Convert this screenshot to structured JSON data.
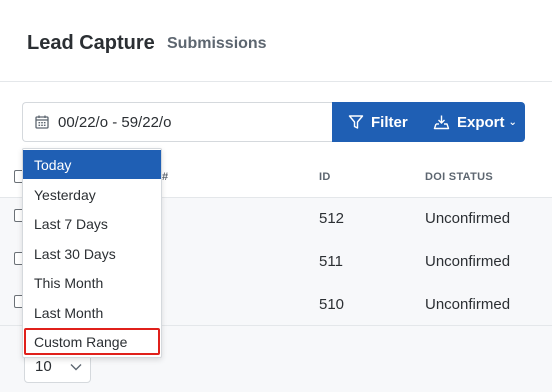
{
  "header": {
    "title": "Lead Capture",
    "subtitle": "Submissions"
  },
  "toolbar": {
    "date_range": "00/22/o - 59/22/o",
    "filter_label": "Filter",
    "export_label": "Export",
    "export_caret": "⌄"
  },
  "table": {
    "columns": [
      "#",
      "ID",
      "DOI STATUS"
    ],
    "rows": [
      {
        "id": "512",
        "doi_status": "Unconfirmed"
      },
      {
        "id": "511",
        "doi_status": "Unconfirmed"
      },
      {
        "id": "510",
        "doi_status": "Unconfirmed"
      }
    ]
  },
  "footer": {
    "page_size": "10"
  },
  "dropdown": {
    "items": [
      "Today",
      "Yesterday",
      "Last 7 Days",
      "Last 30 Days",
      "This Month",
      "Last Month",
      "Custom Range"
    ],
    "active_item": "Today",
    "highlighted_item": "Custom Range"
  },
  "colors": {
    "accent": "#1f5fb4",
    "highlight": "#e0201b"
  }
}
